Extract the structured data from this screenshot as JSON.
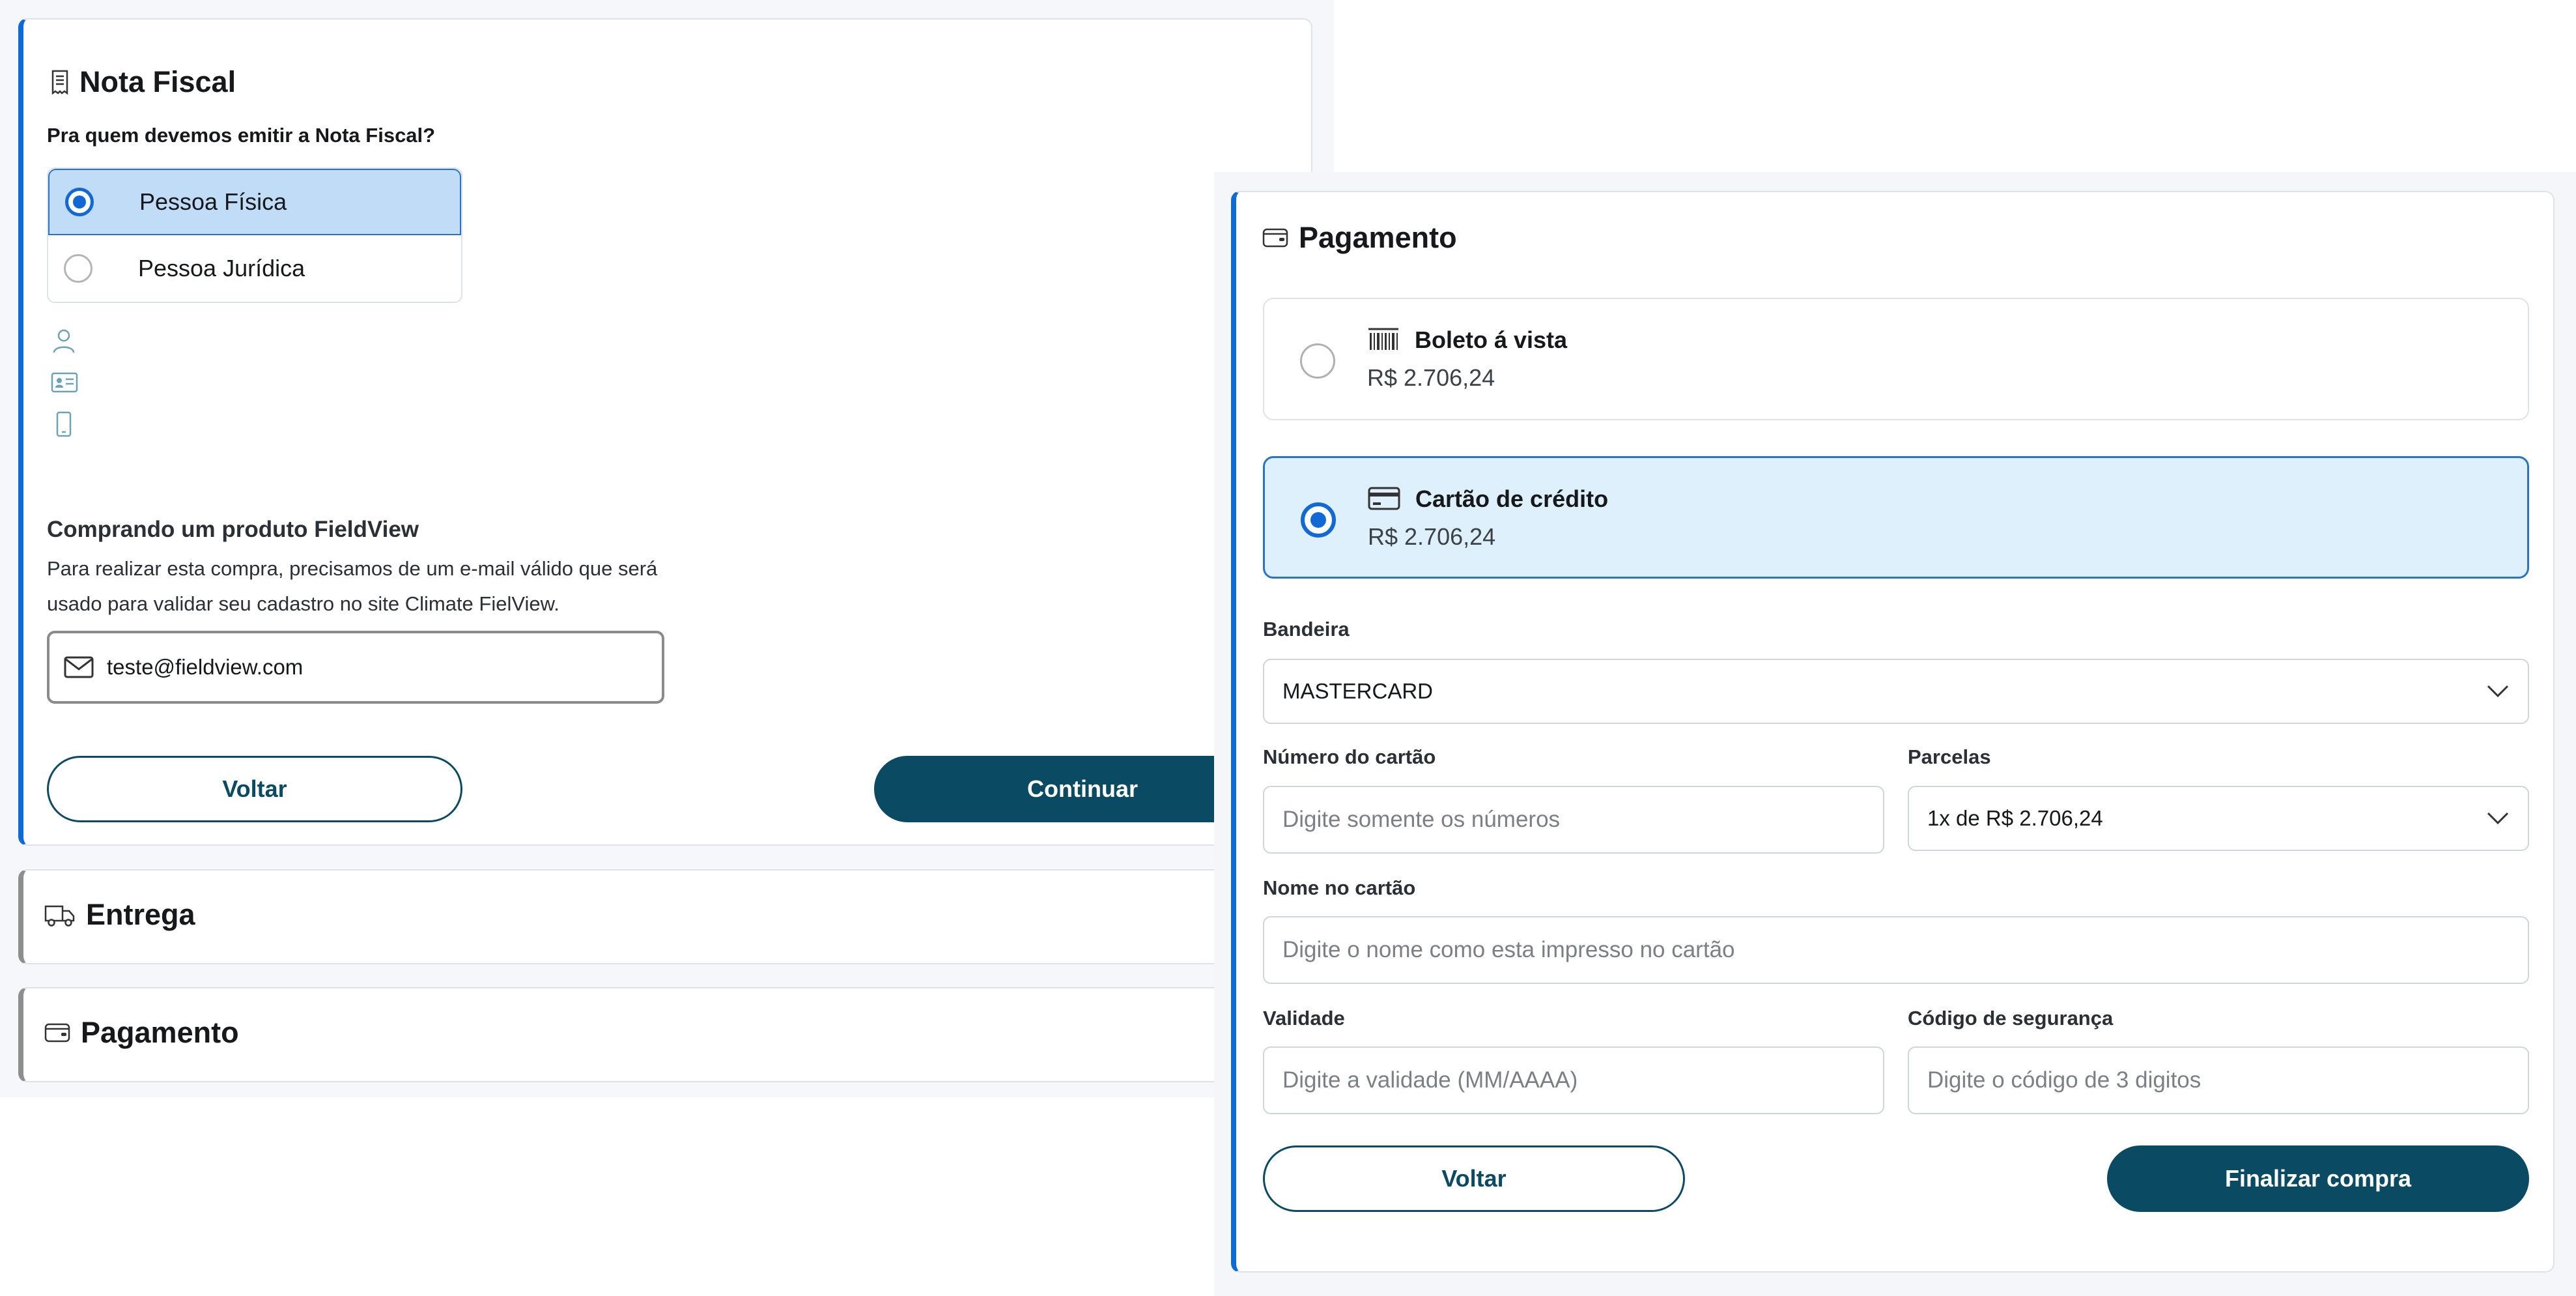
{
  "nota_fiscal": {
    "title": "Nota Fiscal",
    "question": "Pra quem devemos emitir a Nota Fiscal?",
    "options": [
      {
        "label": "Pessoa Física",
        "selected": true
      },
      {
        "label": "Pessoa Jurídica",
        "selected": false
      }
    ],
    "side_icons": [
      "person-icon",
      "id-card-icon",
      "phone-icon"
    ],
    "fieldview": {
      "title": "Comprando um produto FieldView",
      "description": "Para realizar esta compra, precisamos de um e-mail válido que será usado para validar seu cadastro no site Climate FielView.",
      "email_value": "teste@fieldview.com"
    },
    "back_label": "Voltar",
    "continue_label": "Continuar"
  },
  "entrega": {
    "title": "Entrega"
  },
  "pagamento_collapsed": {
    "title": "Pagamento"
  },
  "pagamento": {
    "title": "Pagamento",
    "options": [
      {
        "name": "Boleto á vista",
        "price": "R$ 2.706,24",
        "selected": false,
        "icon": "barcode-icon"
      },
      {
        "name": "Cartão de crédito",
        "price": "R$ 2.706,24",
        "selected": true,
        "icon": "credit-card-icon"
      }
    ],
    "bandeira": {
      "label": "Bandeira",
      "value": "MASTERCARD"
    },
    "numero": {
      "label": "Número do cartão",
      "placeholder": "Digite somente os números"
    },
    "parcelas": {
      "label": "Parcelas",
      "value": "1x de R$ 2.706,24"
    },
    "nome": {
      "label": "Nome no cartão",
      "placeholder": "Digite o nome como esta impresso no cartão"
    },
    "validade": {
      "label": "Validade",
      "placeholder": "Digite a validade (MM/AAAA)"
    },
    "codigo": {
      "label": "Código de segurança",
      "placeholder": "Digite o código de 3 digitos"
    },
    "back_label": "Voltar",
    "finish_label": "Finalizar compra"
  },
  "colors": {
    "accent": "#0d6bd6",
    "primary_button": "#0b4a63",
    "selected_bg": "#c0dcf6",
    "selected_card_bg": "#def0fb"
  }
}
